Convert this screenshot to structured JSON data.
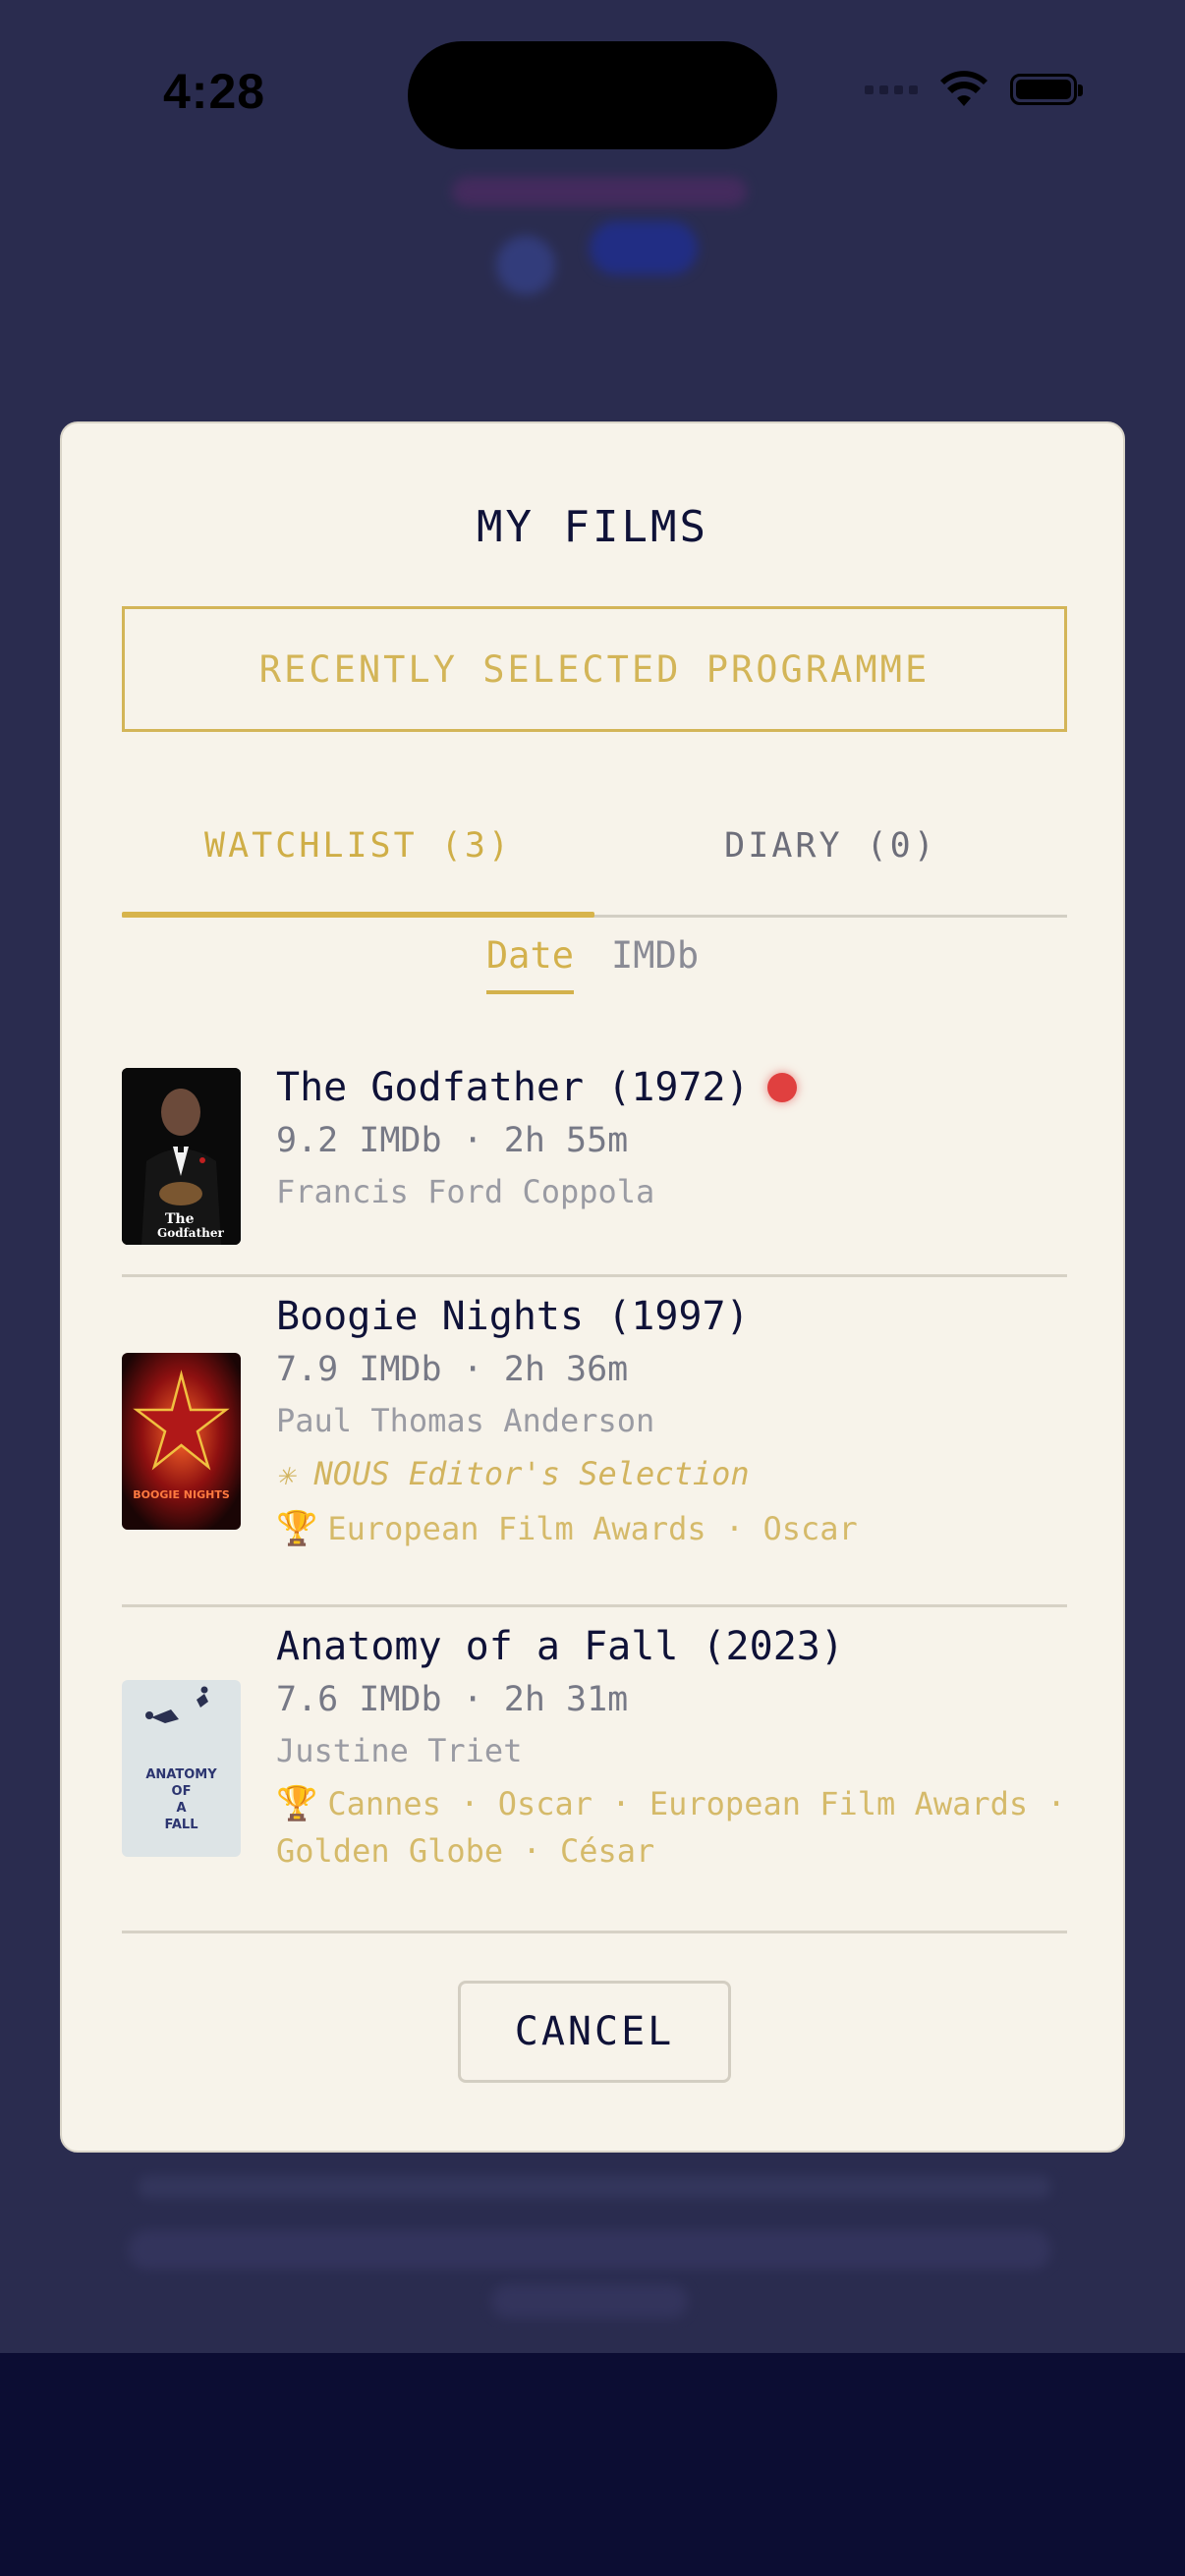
{
  "status_bar": {
    "time": "4:28"
  },
  "modal": {
    "title": "MY FILMS",
    "recent_button": "RECENTLY SELECTED PROGRAMME",
    "tabs": [
      {
        "label": "WATCHLIST (3)",
        "active": true
      },
      {
        "label": "DIARY (0)",
        "active": false
      }
    ],
    "sort": [
      {
        "label": "Date",
        "active": true
      },
      {
        "label": "IMDb",
        "active": false
      }
    ],
    "films": [
      {
        "title": "The Godfather (1972)",
        "meta": "9.2 IMDb · 2h 55m",
        "director": "Francis Ford Coppola",
        "indicator": "red-dot"
      },
      {
        "title": "Boogie Nights (1997)",
        "meta": "7.9 IMDb · 2h 36m",
        "director": "Paul Thomas Anderson",
        "selection": "✳ NOUS Editor's Selection",
        "awards": "European Film Awards · Oscar"
      },
      {
        "title": "Anatomy of a Fall (2023)",
        "meta": "7.6 IMDb · 2h 31m",
        "director": "Justine Triet",
        "awards": "Cannes · Oscar · European Film Awards · Golden Globe · César"
      }
    ],
    "posters": {
      "godfather": {
        "text_line1": "The",
        "text_line2": "Godfather"
      },
      "boogie": {
        "text": "BOOGIE NIGHTS"
      },
      "anatomy": {
        "text_line1": "ANATOMY",
        "text_line2": "OF",
        "text_line3": "A",
        "text_line4": "FALL"
      }
    },
    "cancel_label": "CANCEL"
  },
  "colors": {
    "accent": "#d3b558",
    "ink": "#0f1238",
    "modal_bg": "#f7f3ea",
    "backdrop": "#2a2c4f",
    "recording_dot": "#e0403f"
  }
}
